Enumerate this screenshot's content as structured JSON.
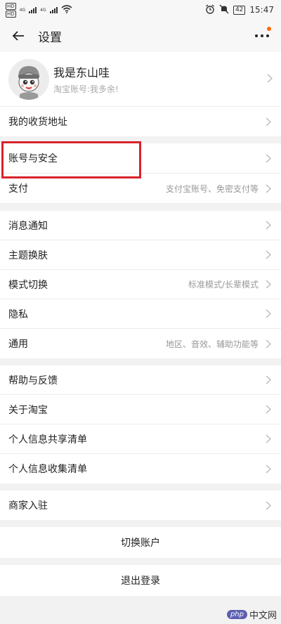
{
  "status": {
    "sims": [
      "HD",
      "HD"
    ],
    "net1": "4G",
    "net2": "4G",
    "battery": "42",
    "time": "15:47"
  },
  "nav": {
    "title": "设置"
  },
  "profile": {
    "name": "我是东山哇",
    "account": "淘宝账号:我多余!"
  },
  "groups": [
    {
      "items": [
        {
          "label": "我的收货地址",
          "value": ""
        }
      ]
    },
    {
      "items": [
        {
          "label": "账号与安全",
          "value": ""
        },
        {
          "label": "支付",
          "value": "支付宝账号、免密支付等"
        }
      ]
    },
    {
      "items": [
        {
          "label": "消息通知",
          "value": ""
        },
        {
          "label": "主题换肤",
          "value": ""
        },
        {
          "label": "模式切换",
          "value": "标准模式/长辈模式"
        },
        {
          "label": "隐私",
          "value": ""
        },
        {
          "label": "通用",
          "value": "地区、音效、辅助功能等"
        }
      ]
    },
    {
      "items": [
        {
          "label": "帮助与反馈",
          "value": ""
        },
        {
          "label": "关于淘宝",
          "value": ""
        },
        {
          "label": "个人信息共享清单",
          "value": ""
        },
        {
          "label": "个人信息收集清单",
          "value": ""
        }
      ]
    },
    {
      "items": [
        {
          "label": "商家入驻",
          "value": ""
        }
      ]
    }
  ],
  "actions": {
    "switch": "切换账户",
    "logout": "退出登录"
  },
  "watermark": {
    "logo": "php",
    "text": "中文网"
  },
  "colors": {
    "highlight": "#d9232c",
    "notify_dot": "#ff6a00"
  },
  "icons": [
    "back-arrow-icon",
    "more-icon",
    "chevron-right-icon",
    "signal-icon",
    "wifi-icon",
    "alarm-icon",
    "mute-icon",
    "battery-icon"
  ]
}
